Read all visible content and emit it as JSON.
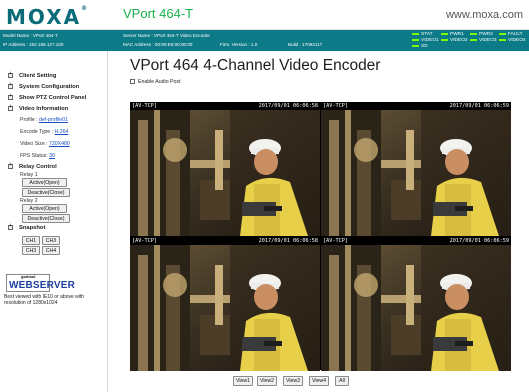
{
  "header": {
    "logo": "MOXA",
    "logo_mark": "®",
    "product": "VPort 464-T",
    "website": "www.moxa.com"
  },
  "infobar": {
    "model_name": "Model Name : VPort 464-T",
    "ip_address": "IP Address : 192.168.127.100",
    "server_name": "Server Name : VPort 464-T Video Encoder",
    "mac_address": "MAC Address : 00:90:E8:00:00:00",
    "firmware": "Firm. Version : 1.0",
    "build": "Build : 17083117",
    "leds": [
      "STAT",
      "PWR1",
      "PWR2",
      "FAULT",
      "VIDEO1",
      "VIDEO2",
      "VIDEO3",
      "VIDEO4",
      "SD"
    ],
    "led_color": "#7CFC00"
  },
  "sidebar": {
    "menu": {
      "client_setting": "Client Setting",
      "system_configuration": "System Configuration",
      "show_ptz": "Show PTZ Control Panel",
      "video_information": "Video Information",
      "relay_control": "Relay Control",
      "snapshot": "Snapshot"
    },
    "video_info": {
      "profile_label": "Profile : ",
      "profile_value": "def-profile01",
      "encode_label": "Encode Type : ",
      "encode_value": "H.264",
      "size_label": "Video Size : ",
      "size_value": "720X480",
      "fps_label": "FPS Status: ",
      "fps_value": "30"
    },
    "relay1": {
      "label": "Relay 1",
      "active": "Active(Open)",
      "deactive": "Deactive(Close)"
    },
    "relay2": {
      "label": "Relay 2",
      "active": "Active(Open)",
      "deactive": "Deactive(Close)"
    },
    "snapshot_buttons": [
      "CH1",
      "CH3",
      "CH3",
      "CH4"
    ],
    "webserver_badge": {
      "small": "goahead",
      "big": "WEBSERVER"
    },
    "note": "Best viewed with IE10 or above with resolution of 1280x1024"
  },
  "main": {
    "title": "VPort 464 4-Channel Video Encoder",
    "enable_audio": "Enable Audio Post",
    "channels": [
      {
        "tag": "[AV-TCP]",
        "timestamp": "2017/09/01 06:06:58"
      },
      {
        "tag": "[AV-TCP]",
        "timestamp": "2017/09/01 06:06:59"
      },
      {
        "tag": "[AV-TCP]",
        "timestamp": "2017/09/01 06:06:58"
      },
      {
        "tag": "[AV-TCP]",
        "timestamp": "2017/09/01 06:06:59"
      }
    ],
    "view_buttons": [
      "View1",
      "View2",
      "View3",
      "View4",
      "All"
    ]
  },
  "colors": {
    "brand": "#0b6b78",
    "product_title": "#19b04b",
    "infobar": "#0d7a88",
    "link": "#1a4fc4"
  }
}
